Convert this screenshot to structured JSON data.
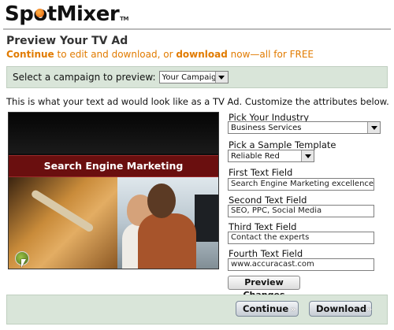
{
  "brand": {
    "logo_pre": "Sp",
    "logo_o": "o",
    "logo_post": "tMixer",
    "tm": "TM"
  },
  "page": {
    "title": "Preview Your TV Ad",
    "subtitle_link1": "Continue",
    "subtitle_mid": " to edit and download, or ",
    "subtitle_link2": "download",
    "subtitle_end": " now—all for FREE"
  },
  "campaign": {
    "label": "Select a campaign to preview:",
    "selected": "Your Campaign"
  },
  "description": "This is what your text ad would look like as a TV Ad. Customize the attributes below.",
  "video": {
    "banner_text": "Search Engine Marketing"
  },
  "form": {
    "industry_label": "Pick Your Industry",
    "industry_value": "Business Services",
    "template_label": "Pick a Sample Template",
    "template_value": "Reliable Red",
    "field1_label": "First Text Field",
    "field1_value": "Search Engine Marketing excellence from Ac",
    "field2_label": "Second Text Field",
    "field2_value": "SEO, PPC, Social Media",
    "field3_label": "Third Text Field",
    "field3_value": "Contact the experts",
    "field4_label": "Fourth Text Field",
    "field4_value": "www.accuracast.com",
    "preview_button": "Preview Changes"
  },
  "footer": {
    "continue_label": "Continue",
    "download_label": "Download",
    "chevron": "»"
  },
  "colors": {
    "accent_orange": "#e17b00",
    "banner_red": "#6a0f0f",
    "panel_green": "#d9e5d9"
  },
  "icons": {
    "play": "play-icon",
    "cursor": "cursor-icon",
    "dropdown": "chevron-down-icon"
  }
}
